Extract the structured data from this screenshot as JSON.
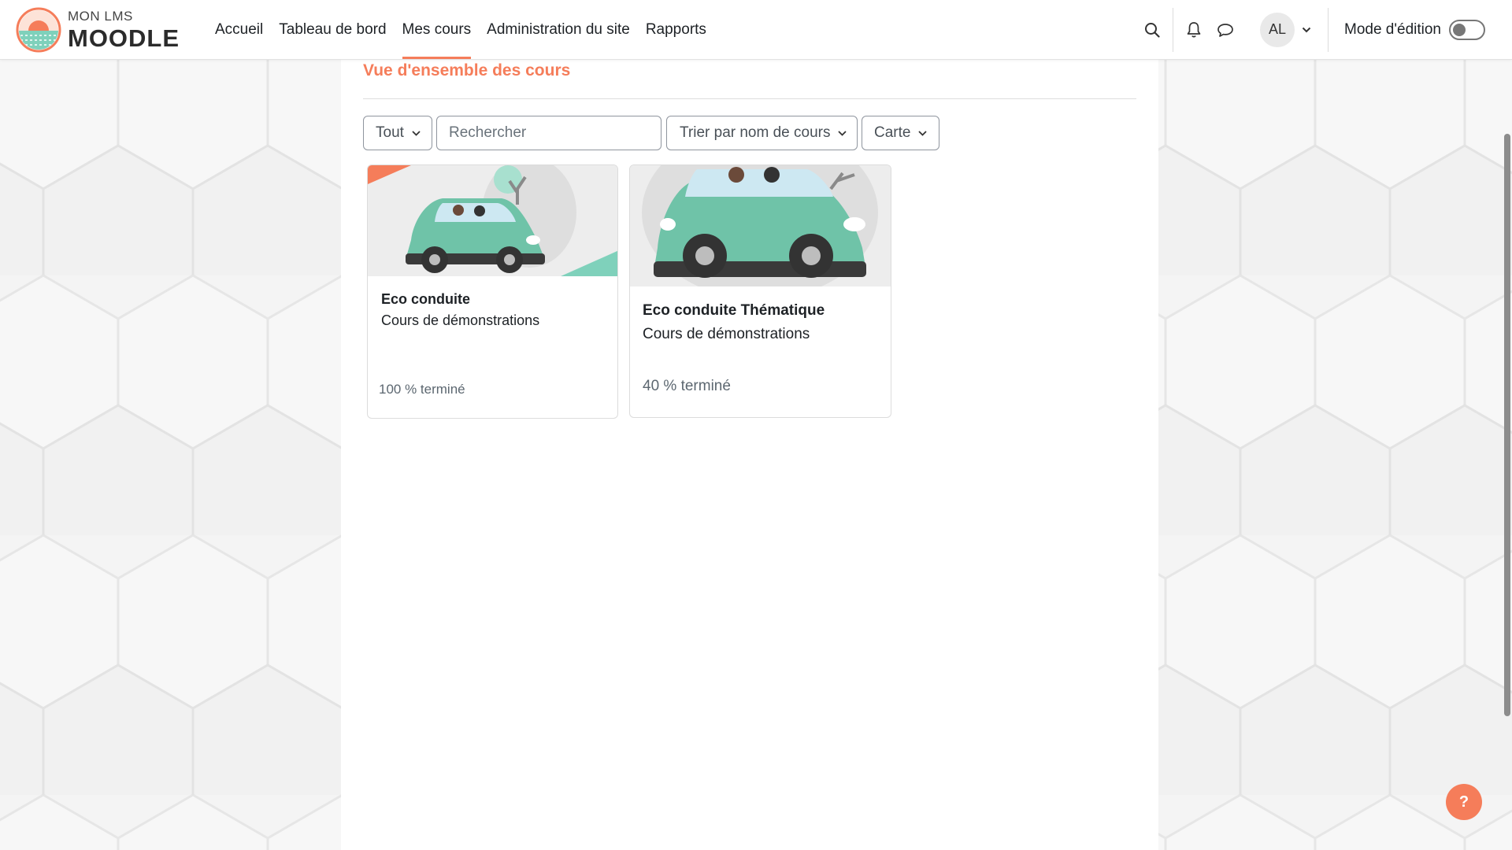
{
  "brand": {
    "small": "MON LMS",
    "big": "MOODLE",
    "accent_color": "#f57d5a"
  },
  "nav": {
    "items": [
      {
        "label": "Accueil",
        "active": false
      },
      {
        "label": "Tableau de bord",
        "active": false
      },
      {
        "label": "Mes cours",
        "active": true
      },
      {
        "label": "Administration du site",
        "active": false
      },
      {
        "label": "Rapports",
        "active": false
      }
    ]
  },
  "user": {
    "initials": "AL",
    "edit_mode_label": "Mode d'édition",
    "edit_mode_on": false,
    "icons": [
      "search-icon",
      "bell-icon",
      "chat-icon",
      "chevron-down-icon"
    ]
  },
  "overview": {
    "title": "Vue d'ensemble des cours",
    "filter_label": "Tout",
    "search_placeholder": "Rechercher",
    "sort_label": "Trier par nom de cours",
    "view_label": "Carte"
  },
  "courses": [
    {
      "name": "Eco conduite",
      "category": "Cours de démonstrations",
      "progress_label": "100 % terminé",
      "progress": 100
    },
    {
      "name": "Eco conduite Thématique",
      "category": "Cours de démonstrations",
      "progress_label": "40 % terminé",
      "progress": 40
    }
  ],
  "help": {
    "label": "?"
  }
}
